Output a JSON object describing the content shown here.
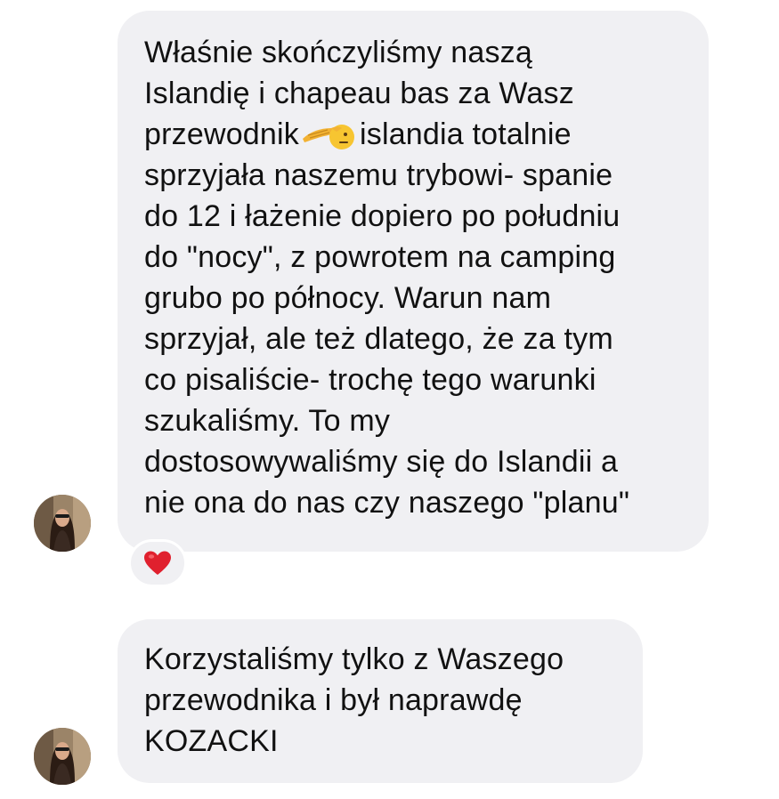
{
  "messages": [
    {
      "id": "msg1",
      "lines": [
        "Właśnie skończyliśmy naszą",
        "Islandię i chapeau bas za Wasz",
        "przewodnik",
        "islandia totalnie",
        "sprzyjała naszemu trybowi- spanie",
        "do 12 i łażenie dopiero po południu",
        "do \"nocy\", z powrotem na camping",
        "grubo po północy. Warun nam",
        "sprzyjał, ale też dlatego, że za tym",
        "co pisaliście- trochę tego warunki",
        "szukaliśmy.  To my",
        "dostosowywaliśmy się do Islandii a",
        "nie ona do nas czy naszego \"planu\""
      ],
      "inline_emoji": "saluting-face-emoji",
      "reaction": "red-heart-emoji",
      "reaction_color": "#e0202e"
    },
    {
      "id": "msg2",
      "lines": [
        "Korzystaliśmy tylko z Waszego",
        "przewodnika i był naprawdę",
        "KOZACKI"
      ]
    }
  ],
  "colors": {
    "bubble": "#f0f0f3",
    "text": "#111111",
    "background": "#ffffff"
  }
}
